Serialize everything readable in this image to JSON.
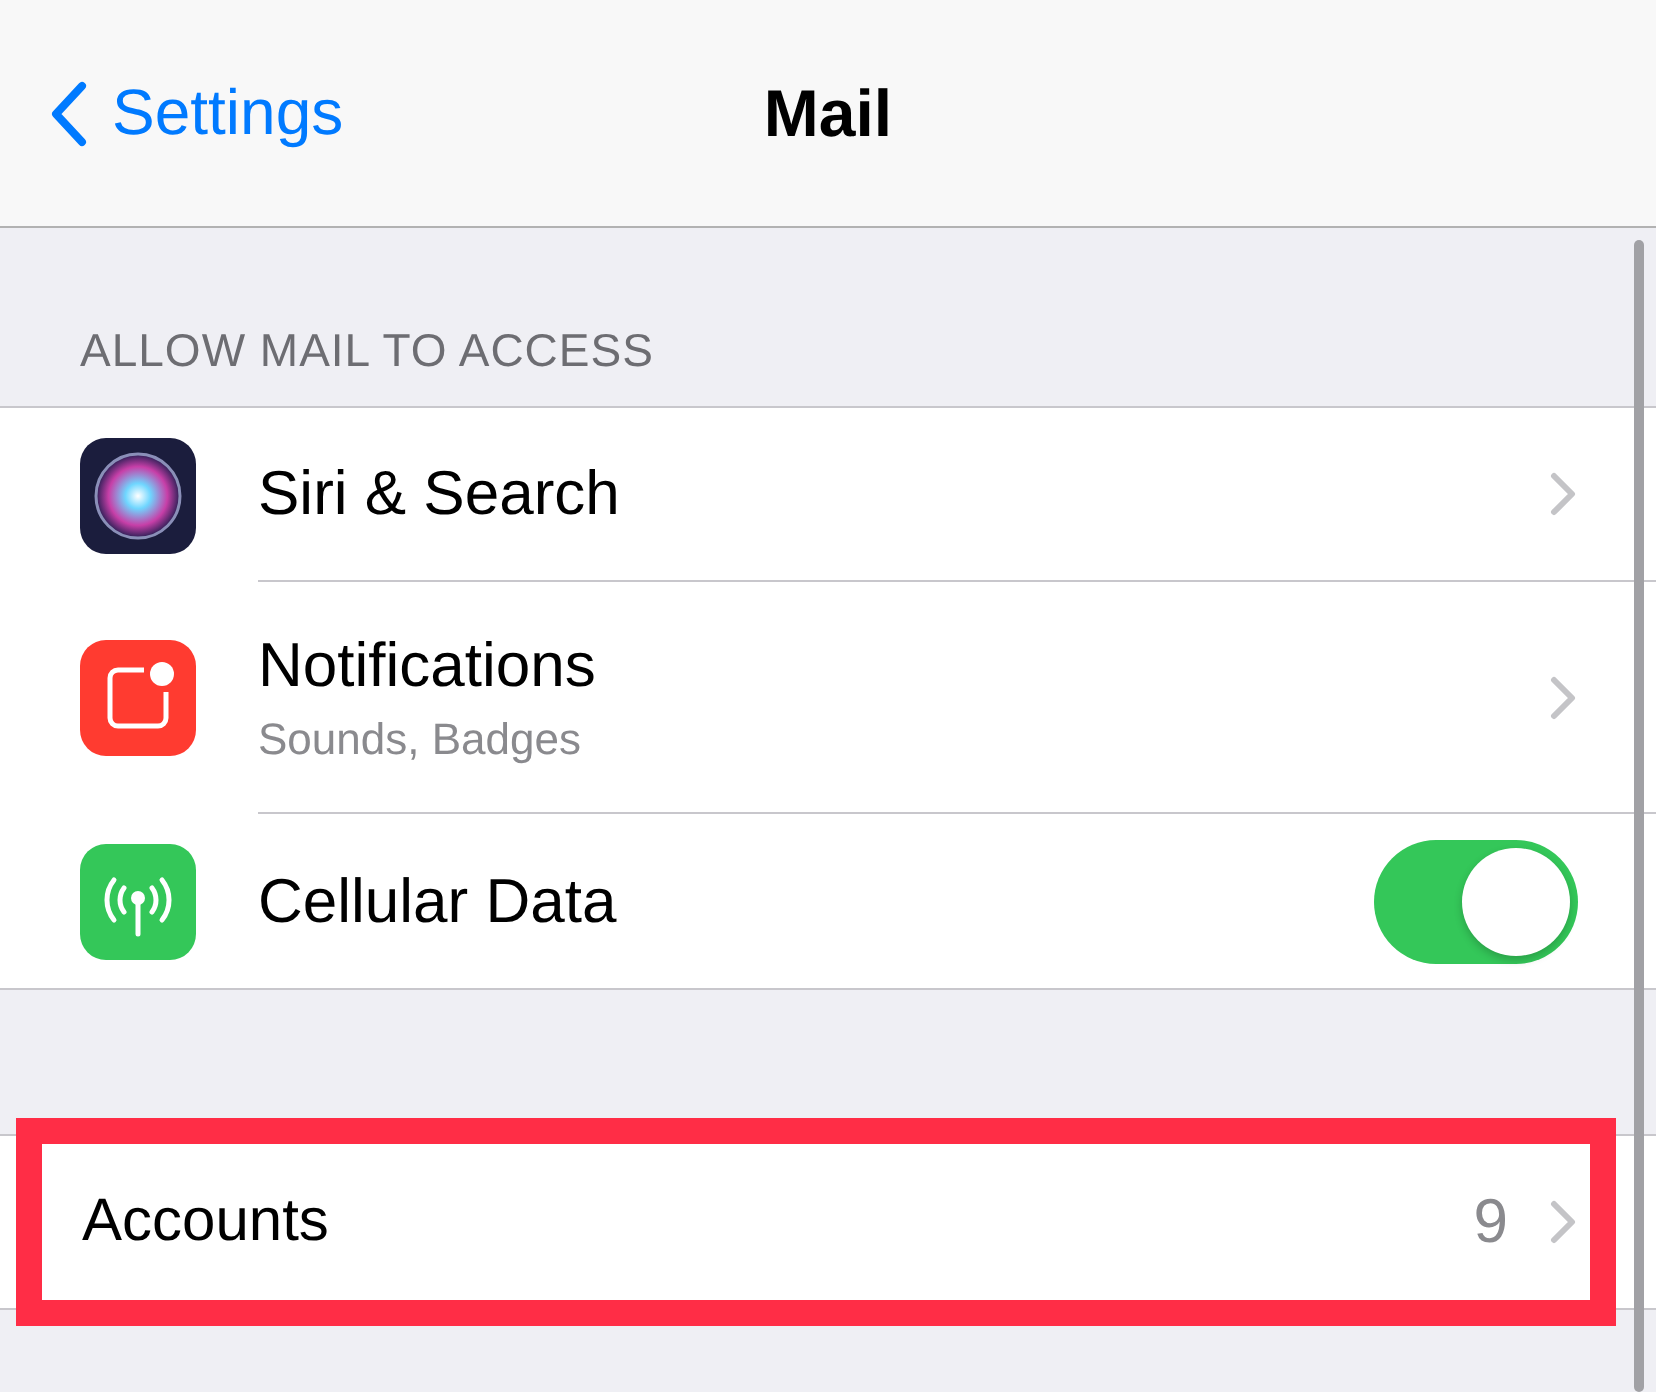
{
  "nav": {
    "back": "Settings",
    "title": "Mail"
  },
  "section": {
    "header": "ALLOW MAIL TO ACCESS",
    "rows": [
      {
        "kind": "link",
        "label": "Siri & Search"
      },
      {
        "kind": "link",
        "label": "Notifications",
        "subtitle": "Sounds, Badges"
      },
      {
        "kind": "toggle",
        "label": "Cellular Data",
        "on": true
      }
    ]
  },
  "accounts": {
    "label": "Accounts",
    "value": "9",
    "highlighted": true
  }
}
